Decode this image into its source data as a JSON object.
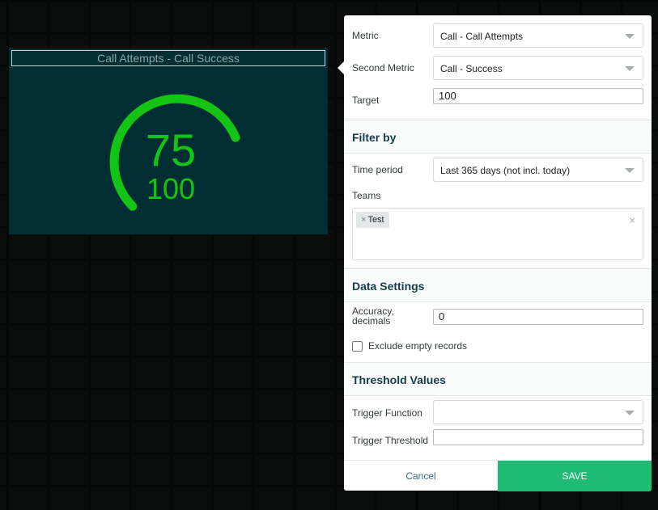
{
  "widget": {
    "title": "Call Attempts - Call Success",
    "value": "75",
    "target": "100",
    "progress": 0.75,
    "accent_color": "#14c414"
  },
  "panel": {
    "metric": {
      "label": "Metric",
      "value": "Call - Call Attempts"
    },
    "second_metric": {
      "label": "Second Metric",
      "value": "Call - Success"
    },
    "target": {
      "label": "Target",
      "value": "100"
    },
    "filter_section": {
      "title": "Filter by"
    },
    "time_period": {
      "label": "Time period",
      "value": "Last 365 days (not incl. today)"
    },
    "teams": {
      "label": "Teams",
      "tags": [
        "Test"
      ],
      "tag_remove": "×",
      "clear": "×"
    },
    "data_section": {
      "title": "Data Settings"
    },
    "accuracy": {
      "label_line1": "Accuracy,",
      "label_line2": "decimals",
      "value": "0"
    },
    "exclude_empty": {
      "label": "Exclude empty records",
      "checked": false
    },
    "threshold_section": {
      "title": "Threshold Values"
    },
    "trigger_function": {
      "label": "Trigger Function",
      "value": ""
    },
    "trigger_threshold": {
      "label": "Trigger Threshold",
      "value": ""
    },
    "cancel_label": "Cancel",
    "save_label": "SAVE",
    "save_color": "#1dbb73"
  }
}
